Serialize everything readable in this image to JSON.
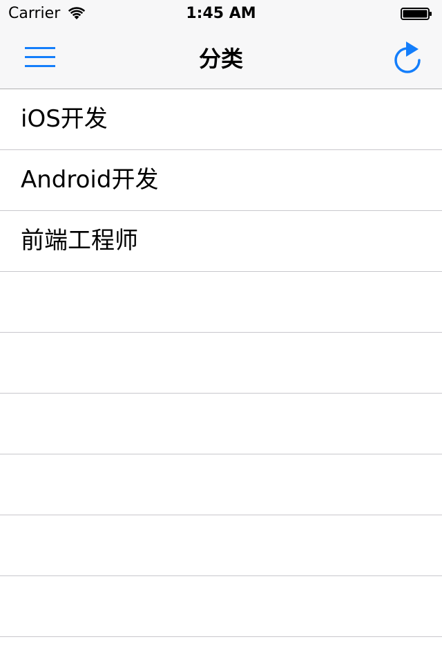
{
  "status_bar": {
    "carrier": "Carrier",
    "time": "1:45 AM",
    "wifi_icon": "wifi-icon",
    "battery_icon": "battery-icon"
  },
  "nav": {
    "title": "分类",
    "left_icon": "hamburger-menu-icon",
    "right_icon": "refresh-icon",
    "accent_color": "#147efb"
  },
  "list": {
    "rows": [
      {
        "label": "iOS开发"
      },
      {
        "label": "Android开发"
      },
      {
        "label": "前端工程师"
      },
      {
        "label": ""
      },
      {
        "label": ""
      },
      {
        "label": ""
      },
      {
        "label": ""
      },
      {
        "label": ""
      },
      {
        "label": ""
      }
    ]
  }
}
